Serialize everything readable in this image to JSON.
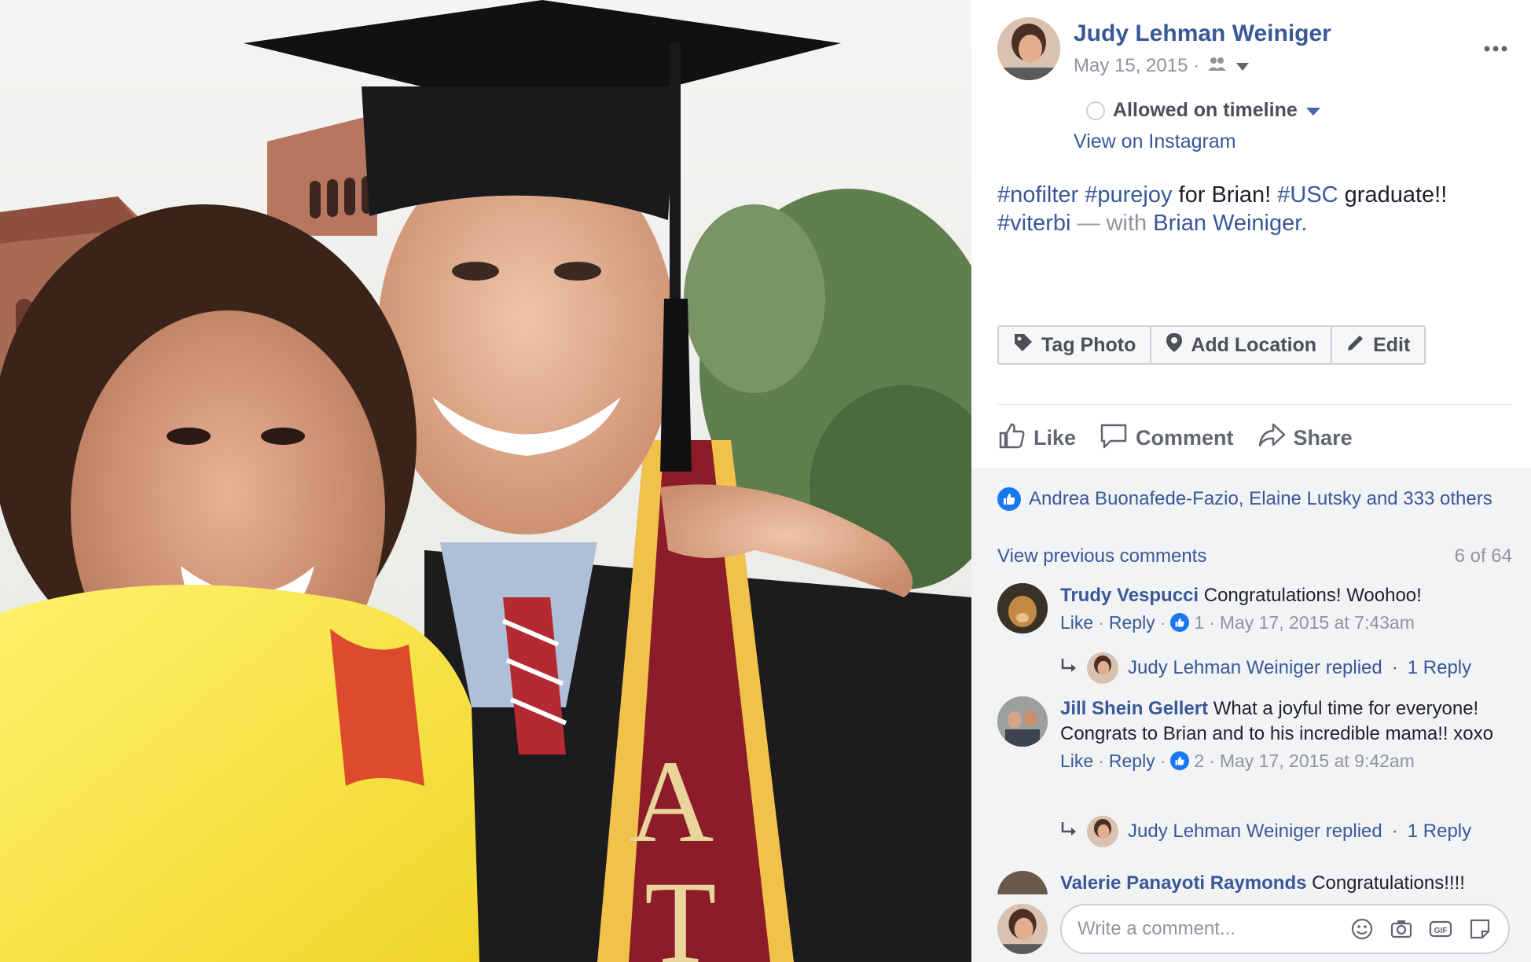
{
  "post": {
    "author": "Judy Lehman Weiniger",
    "date": "May 15, 2015 ·",
    "timeline_option": "Allowed on timeline",
    "view_on_instagram": "View on Instagram",
    "caption": {
      "tag1": "#nofilter",
      "tag2": "#purejoy",
      "text1": " for Brian! ",
      "tag3": "#USC",
      "text2": " graduate!!",
      "tag4": "#viterbi",
      "with_text": " — with ",
      "with_person": "Brian Weiniger",
      "period": "."
    }
  },
  "photo_actions": {
    "tag_photo": "Tag Photo",
    "add_location": "Add Location",
    "edit": "Edit"
  },
  "actions": {
    "like": "Like",
    "comment": "Comment",
    "share": "Share"
  },
  "reactions": {
    "summary": "Andrea Buonafede-Fazio, Elaine Lutsky and 333 others"
  },
  "comments_section": {
    "view_previous": "View previous comments",
    "count": "6 of 64",
    "items": [
      {
        "author": "Trudy Vespucci",
        "text": "Congratulations! Woohoo!",
        "like": "Like",
        "reply": "Reply",
        "likes": "1",
        "time": "May 17, 2015 at 7:43am",
        "replied_text": "Judy Lehman Weiniger replied",
        "reply_count": "1 Reply"
      },
      {
        "author": "Jill Shein Gellert",
        "text": "What a joyful time for everyone! Congrats to Brian and to his incredible mama!! xoxo",
        "like": "Like",
        "reply": "Reply",
        "likes": "2",
        "time": "May 17, 2015 at 9:42am",
        "replied_text": "Judy Lehman Weiniger replied",
        "reply_count": "1 Reply"
      },
      {
        "author": "Valerie Panayoti Raymonds",
        "text": "Congratulations!!!!"
      }
    ]
  },
  "composer": {
    "placeholder": "Write a comment..."
  },
  "icons": {
    "more": "more-options-icon",
    "audience": "friends-icon",
    "dropdown": "caret-down-icon",
    "tag": "tag-icon",
    "location": "location-pin-icon",
    "edit": "pencil-icon",
    "like": "thumbs-up-icon",
    "comment": "speech-bubble-icon",
    "share": "share-arrow-icon",
    "emoji": "smiley-icon",
    "camera": "camera-icon",
    "gif": "gif-icon",
    "sticker": "sticker-icon"
  },
  "colors": {
    "link": "#385898",
    "like_blue": "#1877f2",
    "muted": "#90949c",
    "comments_bg": "#f2f3f5"
  }
}
